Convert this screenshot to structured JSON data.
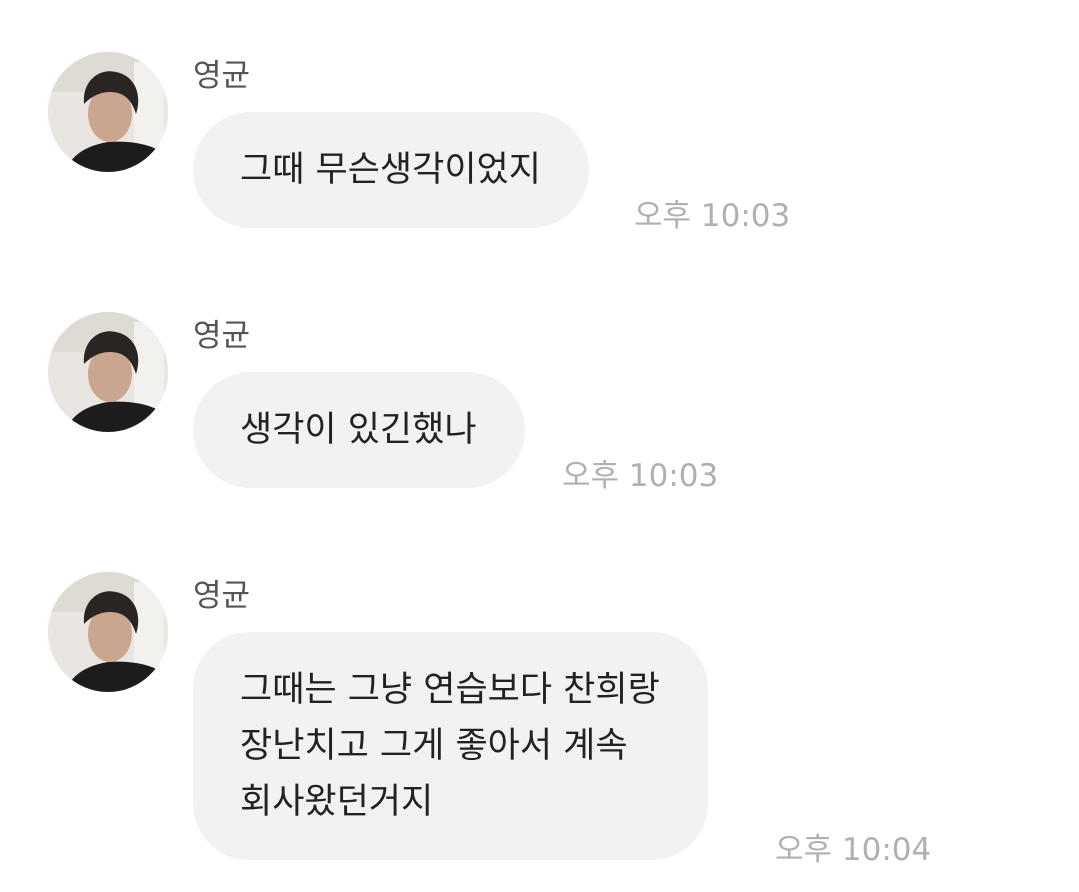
{
  "messages": [
    {
      "sender": "영균",
      "lines": [
        "그때 무슨생각이었지"
      ],
      "time": "오후 10:03"
    },
    {
      "sender": "영균",
      "lines": [
        "생각이 있긴했나"
      ],
      "time": "오후 10:03"
    },
    {
      "sender": "영균",
      "lines": [
        "그때는 그냥 연습보다 찬희랑",
        "장난치고 그게 좋아서 계속",
        "회사왔던거지"
      ],
      "time": "오후 10:04"
    }
  ],
  "colors": {
    "bubble": "#f2f2f4",
    "sender": "#555555",
    "text": "#222222",
    "time": "#b0b0b0"
  }
}
